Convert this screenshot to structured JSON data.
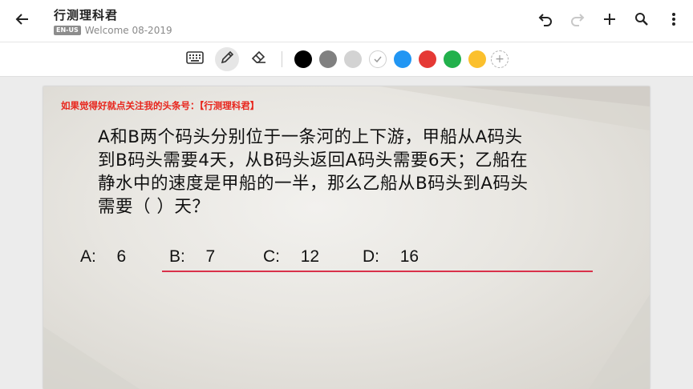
{
  "header": {
    "title": "行测理科君",
    "lang_badge": "EN-US",
    "subtitle": "Welcome 08-2019"
  },
  "icons": {
    "back": "arrow-left-icon",
    "undo": "undo-icon",
    "redo": "redo-icon",
    "add": "plus-icon",
    "search": "search-icon",
    "more": "more-vert-icon",
    "keyboard": "keyboard-icon",
    "pen": "pen-icon",
    "eraser": "eraser-icon"
  },
  "palette": [
    "#000000",
    "#808080",
    "#d3d3d3",
    "#ffffff",
    "#2196f3",
    "#e53935",
    "#22b14c",
    "#fbc02d"
  ],
  "slide": {
    "promo": "如果觉得好就点关注我的头条号：【行测理科君】",
    "question_lines": [
      "A和B两个码头分别位于一条河的上下游，甲船从A码头",
      "到B码头需要4天，从B码头返回A码头需要6天；乙船在",
      "静水中的速度是甲船的一半，那么乙船从B码头到A码头",
      "需要（   ）天？"
    ],
    "options": [
      {
        "label": "A:",
        "value": "6"
      },
      {
        "label": "B:",
        "value": "7"
      },
      {
        "label": "C:",
        "value": "12"
      },
      {
        "label": "D:",
        "value": "16"
      }
    ],
    "colors": {
      "promo": "#e8251c",
      "answer_line": "#d9314a"
    }
  }
}
